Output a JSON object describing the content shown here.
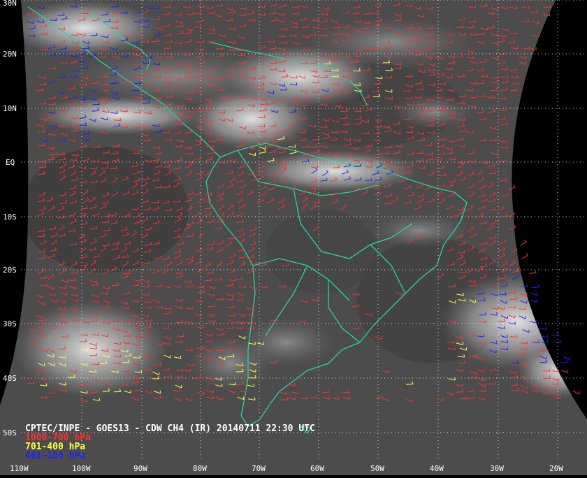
{
  "caption": {
    "title": "CPTEC/INPE - GOES13 - CDW CH4 (IR) 20140711 22:30 UTC",
    "legend": [
      {
        "label": "1000-700 hPa",
        "color": "#ff3030"
      },
      {
        "label": "701-400 hPa",
        "color": "#ffff40"
      },
      {
        "label": "401-100 hPa",
        "color": "#2020ff"
      }
    ]
  },
  "lat_labels": [
    "30N",
    "20N",
    "10N",
    "EQ",
    "10S",
    "20S",
    "30S",
    "40S",
    "50S"
  ],
  "lon_labels": [
    "110W",
    "100W",
    "90W",
    "80W",
    "70W",
    "60W",
    "50W",
    "40W",
    "30W",
    "20W"
  ],
  "colors": {
    "background": "#000000",
    "coast": "#20d8a0",
    "grid": "#ffffff",
    "low_level": "#ff3030",
    "mid_level": "#ffff40",
    "high_level": "#2020ff"
  }
}
